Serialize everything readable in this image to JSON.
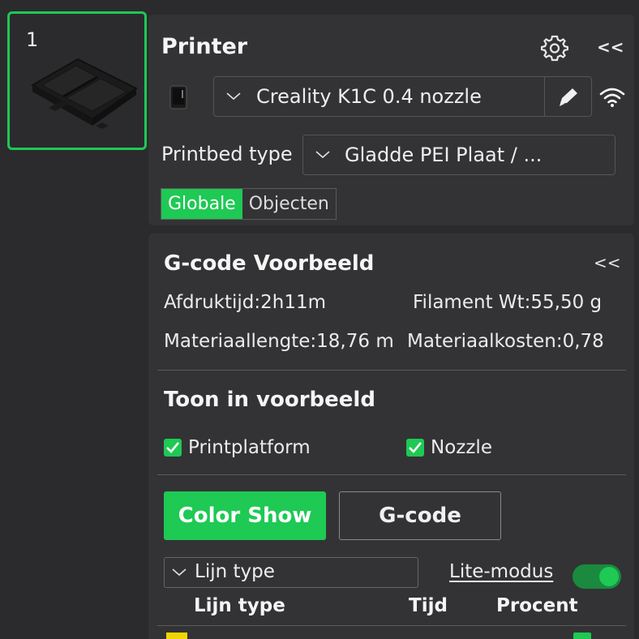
{
  "plate": {
    "number": "1"
  },
  "printer": {
    "title": "Printer",
    "collapse_label": "<<",
    "selected_printer": "Creality K1C 0.4 nozzle",
    "bed_label": "Printbed type",
    "bed_value": "Gladde PEI Plaat / ...",
    "tabs": [
      {
        "label": "Globale",
        "active": true
      },
      {
        "label": "Objecten",
        "active": false
      }
    ]
  },
  "gcode": {
    "title": "G-code Voorbeeld",
    "collapse_label": "<<",
    "print_time": "Afdruktijd:2h11m",
    "filament_weight": "Filament Wt:55,50 g",
    "material_length": "Materiaallengte:18,76 m",
    "material_cost": "Materiaalkosten:0,78",
    "show_section_title": "Toon in voorbeeld",
    "checkboxes": [
      {
        "label": "Printplatform",
        "checked": true
      },
      {
        "label": "Nozzle",
        "checked": true
      }
    ],
    "color_show_button": "Color Show",
    "gcode_button": "G-code",
    "linetype_select": "Lijn type",
    "lite_mode_label": "Lite-modus",
    "lite_mode_on": true,
    "table": {
      "headers": [
        "Lijn type",
        "Tijd",
        "Procent"
      ],
      "first_row": {
        "swatch_color": "#f2d600"
      }
    }
  },
  "colors": {
    "accent": "#1ec954",
    "panel": "#333335",
    "background": "#2b2b2d"
  }
}
